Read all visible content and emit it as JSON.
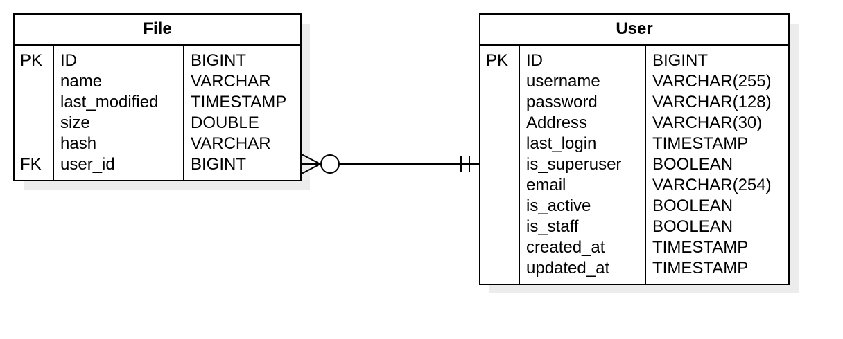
{
  "entities": {
    "file": {
      "title": "File",
      "rows": [
        {
          "key": "PK",
          "name": "ID",
          "type": "BIGINT"
        },
        {
          "key": "",
          "name": "name",
          "type": "VARCHAR"
        },
        {
          "key": "",
          "name": "last_modified",
          "type": "TIMESTAMP"
        },
        {
          "key": "",
          "name": "size",
          "type": "DOUBLE"
        },
        {
          "key": "",
          "name": "hash",
          "type": "VARCHAR"
        },
        {
          "key": "FK",
          "name": "user_id",
          "type": "BIGINT"
        }
      ]
    },
    "user": {
      "title": "User",
      "rows": [
        {
          "key": "PK",
          "name": "ID",
          "type": "BIGINT"
        },
        {
          "key": "",
          "name": "username",
          "type": "VARCHAR(255)"
        },
        {
          "key": "",
          "name": "password",
          "type": "VARCHAR(128)"
        },
        {
          "key": "",
          "name": "Address",
          "type": "VARCHAR(30)"
        },
        {
          "key": "",
          "name": "last_login",
          "type": "TIMESTAMP"
        },
        {
          "key": "",
          "name": "is_superuser",
          "type": "BOOLEAN"
        },
        {
          "key": "",
          "name": "email",
          "type": "VARCHAR(254)"
        },
        {
          "key": "",
          "name": "is_active",
          "type": "BOOLEAN"
        },
        {
          "key": "",
          "name": "is_staff",
          "type": "BOOLEAN"
        },
        {
          "key": "",
          "name": "created_at",
          "type": "TIMESTAMP"
        },
        {
          "key": "",
          "name": "updated_at",
          "type": "TIMESTAMP"
        }
      ]
    }
  },
  "relationship": {
    "from_end": "zero-or-many",
    "to_end": "exactly-one"
  }
}
